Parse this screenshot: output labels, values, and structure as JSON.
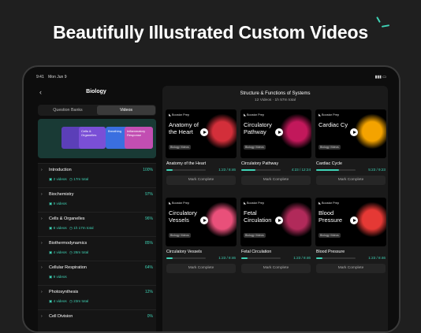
{
  "headline": "Beautifully Illustrated Custom Videos",
  "status": {
    "time": "9:41",
    "date": "Mon Jun 9"
  },
  "sidebar": {
    "title": "Biology",
    "tabs": [
      "Question Banks",
      "Videos"
    ],
    "banner_cards": [
      "Cells & Organelles",
      "Breathing",
      "Inflammatory Response"
    ],
    "items": [
      {
        "name": "Introduction",
        "pct": "100%",
        "videos": "2 videos",
        "total": "17m total"
      },
      {
        "name": "Biochemistry",
        "pct": "97%",
        "videos": "9 videos",
        "total": ""
      },
      {
        "name": "Cells & Organelles",
        "pct": "96%",
        "videos": "8 videos",
        "total": "1h 17m total"
      },
      {
        "name": "Biothermodynamics",
        "pct": "85%",
        "videos": "4 videos",
        "total": "28m total"
      },
      {
        "name": "Cellular Respiration",
        "pct": "64%",
        "videos": "9 videos",
        "total": ""
      },
      {
        "name": "Photosynthesis",
        "pct": "12%",
        "videos": "4 videos",
        "total": "23m total"
      },
      {
        "name": "Cell Division",
        "pct": "0%",
        "videos": "",
        "total": ""
      }
    ]
  },
  "main": {
    "title": "Structure & Functions of Systems",
    "meta": "12 Videos  ·  1h 57m total",
    "brand": "Boostar Prep",
    "tag": "Biology Videos",
    "mark_label": "Mark Complete",
    "cards": [
      {
        "title": "Anatomy of the Heart",
        "name": "Anatomy of the Heart",
        "time": "1:23 / 8:46",
        "progress": 0.15,
        "color": "#d32f3a"
      },
      {
        "title": "Circulatory Pathway",
        "name": "Circulatory Pathway",
        "time": "4:23 / 12:24",
        "progress": 0.35,
        "color": "#c2185b"
      },
      {
        "title": "Cardiac Cy",
        "name": "Cardiac Cycle",
        "time": "5:23 / 9:23",
        "progress": 0.58,
        "color": "#f4a300"
      },
      {
        "title": "Circulatory Vessels",
        "name": "Circulatory Vessels",
        "time": "1:23 / 8:46",
        "progress": 0.15,
        "color": "#e9507a"
      },
      {
        "title": "Fetal Circulation",
        "name": "Fetal Circulation",
        "time": "1:23 / 8:46",
        "progress": 0.15,
        "color": "#b12a5a"
      },
      {
        "title": "Blood Pressure",
        "name": "Blood Pressure",
        "time": "1:23 / 8:46",
        "progress": 0.15,
        "color": "#e53935"
      }
    ]
  }
}
